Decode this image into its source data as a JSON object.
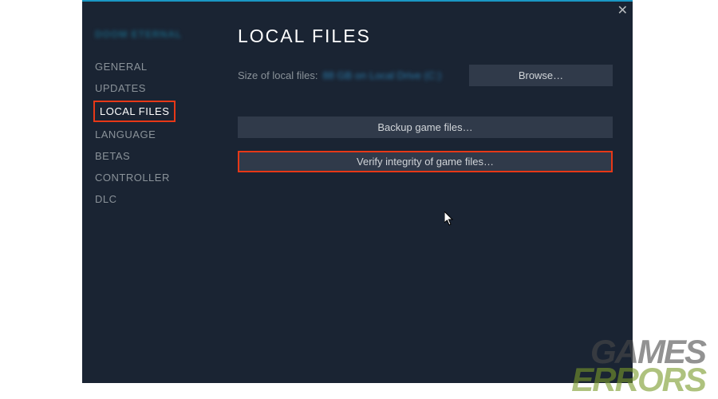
{
  "dialog": {
    "game_title": "DOOM ETERNAL",
    "close": "✕"
  },
  "sidebar": {
    "items": [
      {
        "label": "GENERAL",
        "active": false
      },
      {
        "label": "UPDATES",
        "active": false
      },
      {
        "label": "LOCAL FILES",
        "active": true
      },
      {
        "label": "LANGUAGE",
        "active": false
      },
      {
        "label": "BETAS",
        "active": false
      },
      {
        "label": "CONTROLLER",
        "active": false
      },
      {
        "label": "DLC",
        "active": false
      }
    ]
  },
  "main": {
    "title": "LOCAL FILES",
    "size_label": "Size of local files:",
    "size_value": "88 GB on Local Drive (C:)",
    "browse_label": "Browse…",
    "backup_label": "Backup game files…",
    "verify_label": "Verify integrity of game files…"
  },
  "watermark": {
    "line1": "GAMES",
    "line2": "ERRORS"
  }
}
